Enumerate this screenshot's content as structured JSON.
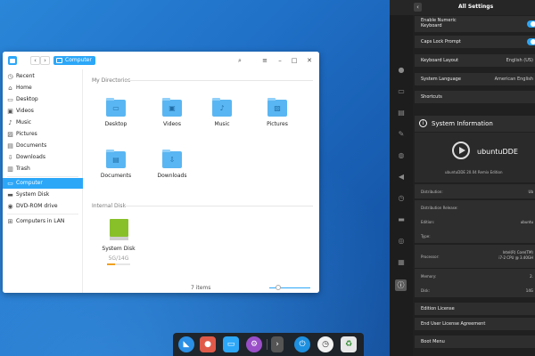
{
  "file_manager": {
    "breadcrumb": "Computer",
    "sidebar": [
      {
        "label": "Recent",
        "icon": "clock-icon"
      },
      {
        "label": "Home",
        "icon": "home-icon"
      },
      {
        "label": "Desktop",
        "icon": "desktop-icon"
      },
      {
        "label": "Videos",
        "icon": "video-icon"
      },
      {
        "label": "Music",
        "icon": "music-icon"
      },
      {
        "label": "Pictures",
        "icon": "picture-icon"
      },
      {
        "label": "Documents",
        "icon": "document-icon"
      },
      {
        "label": "Downloads",
        "icon": "download-icon"
      },
      {
        "label": "Trash",
        "icon": "trash-icon"
      },
      {
        "label": "Computer",
        "icon": "computer-icon",
        "active": true
      },
      {
        "label": "System Disk",
        "icon": "disk-icon"
      },
      {
        "label": "DVD-ROM drive",
        "icon": "dvd-icon"
      },
      {
        "label": "Computers in LAN",
        "icon": "network-icon"
      }
    ],
    "my_directories_title": "My Directories",
    "directories": [
      "Desktop",
      "Videos",
      "Music",
      "Pictures",
      "Documents",
      "Downloads"
    ],
    "internal_disk_title": "Internal Disk",
    "disk_label": "System Disk",
    "disk_usage": "5G/14G",
    "status": "7 items"
  },
  "settings": {
    "title": "All Settings",
    "rows_top": [
      {
        "label": "Enable Numeric Keyboard",
        "toggle": true
      },
      {
        "label": "Caps Lock Prompt",
        "toggle": true
      },
      {
        "label": "Keyboard Layout",
        "value": "English (US)"
      },
      {
        "label": "System Language",
        "value": "American English"
      },
      {
        "label": "Shortcuts",
        "value": ""
      }
    ],
    "system_info_title": "System Information",
    "brand": "ubuntuDDE",
    "edition_text": "ubuntuDDE 20.04 Remix Edition",
    "info": [
      {
        "key": "Distribution:",
        "value": "Ub"
      },
      {
        "key": "Distribution Release:",
        "value": ""
      },
      {
        "key": "Edition:",
        "value": "ubuntu"
      },
      {
        "key": "Type:",
        "value": ""
      },
      {
        "key": "Processor:",
        "value": "Intel(R) Core(TM) i7-2 CPU @ 3.40GH"
      },
      {
        "key": "Memory:",
        "value": "2."
      },
      {
        "key": "Disk:",
        "value": "14G"
      }
    ],
    "rows_bottom": [
      "Edition License",
      "End User License Agreement",
      "Boot Menu"
    ]
  }
}
